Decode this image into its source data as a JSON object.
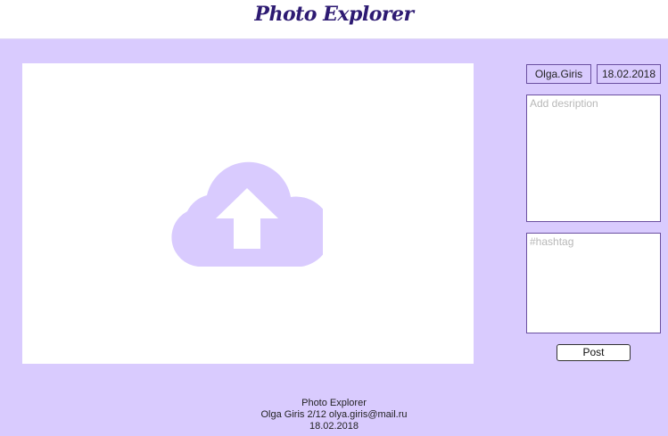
{
  "header": {
    "logo_text": "Photo Explorer"
  },
  "upload": {
    "icon": "cloud-upload-icon"
  },
  "meta": {
    "username": "Olga.Giris",
    "date": "18.02.2018"
  },
  "form": {
    "description_placeholder": "Add desription",
    "hashtag_placeholder": "#hashtag",
    "post_label": "Post"
  },
  "footer": {
    "line1": "Photo Explorer",
    "line2": "Olga Giris 2/12 olya.giris@mail.ru",
    "line3": "18.02.2018"
  },
  "colors": {
    "background": "#d9cbfe",
    "logo": "#2d1a72",
    "icon": "#d9cbfe",
    "border": "#6a4fa0"
  }
}
